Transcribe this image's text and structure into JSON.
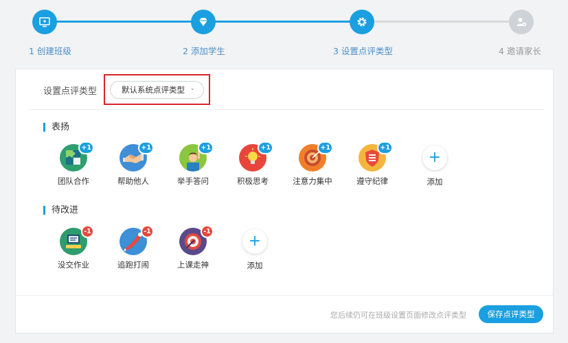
{
  "stepper": {
    "steps": [
      {
        "label": "1 创建班级",
        "status": "done",
        "icon": "monitor-icon"
      },
      {
        "label": "2 添加学生",
        "status": "done",
        "icon": "diamond-icon"
      },
      {
        "label": "3 设置点评类型",
        "status": "current",
        "icon": "gear-icon"
      },
      {
        "label": "4 邀请家长",
        "status": "todo",
        "icon": "add-user-icon"
      }
    ],
    "colors": {
      "done": "#1a9fe0",
      "todo": "#cfd2d6"
    }
  },
  "type_setting": {
    "label": "设置点评类型",
    "selected": "默认系统点评类型"
  },
  "praise": {
    "title": "表扬",
    "badge": "+1",
    "items": [
      {
        "label": "团队合作",
        "icon": "puzzle-icon"
      },
      {
        "label": "帮助他人",
        "icon": "handshake-icon"
      },
      {
        "label": "举手答问",
        "icon": "raise-hand-icon"
      },
      {
        "label": "积极思考",
        "icon": "lightbulb-icon"
      },
      {
        "label": "注意力集中",
        "icon": "target-icon"
      },
      {
        "label": "遵守纪律",
        "icon": "shield-icon"
      }
    ],
    "add_label": "添加"
  },
  "improve": {
    "title": "待改进",
    "badge": "-1",
    "items": [
      {
        "label": "没交作业",
        "icon": "homework-icon"
      },
      {
        "label": "追跑打闹",
        "icon": "running-icon"
      },
      {
        "label": "上课走神",
        "icon": "distracted-icon"
      }
    ],
    "add_label": "添加"
  },
  "footer": {
    "note": "您后续仍可在班级设置页面修改点评类型",
    "save_label": "保存点评类型"
  }
}
